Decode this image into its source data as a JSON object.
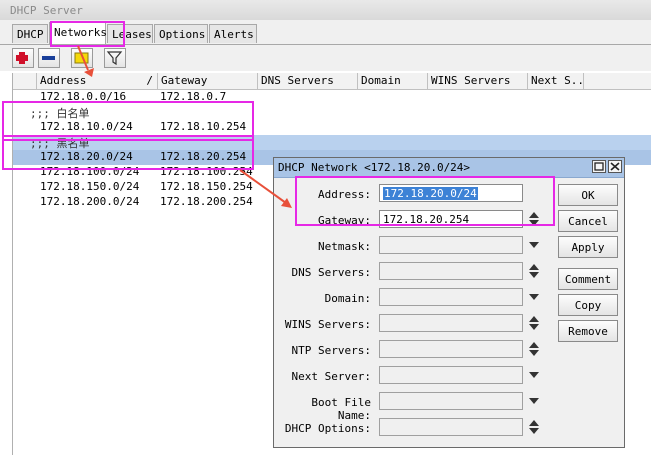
{
  "window": {
    "title": "DHCP Server"
  },
  "tabs": [
    "DHCP",
    "Networks",
    "Leases",
    "Options",
    "Alerts"
  ],
  "active_tab": "Networks",
  "toolbar": {
    "add_icon": "plus-icon",
    "remove_icon": "minus-icon",
    "comment_icon": "note-icon",
    "filter_icon": "filter-icon"
  },
  "table": {
    "columns": [
      "Address",
      "Gateway",
      "DNS Servers",
      "Domain",
      "WINS Servers",
      "Next S..."
    ],
    "sort_indicator": "/",
    "rows": [
      {
        "address": "172.18.0.0/16",
        "gateway": "172.18.0.7"
      },
      {
        "comment": ";;; 白名单"
      },
      {
        "address": "172.18.10.0/24",
        "gateway": "172.18.10.254"
      },
      {
        "comment": ";;; 黑名单"
      },
      {
        "address": "172.18.20.0/24",
        "gateway": "172.18.20.254"
      },
      {
        "address": "172.18.100.0/24",
        "gateway": "172.18.100.254"
      },
      {
        "address": "172.18.150.0/24",
        "gateway": "172.18.150.254"
      },
      {
        "address": "172.18.200.0/24",
        "gateway": "172.18.200.254"
      }
    ]
  },
  "dialog": {
    "title": "DHCP Network <172.18.20.0/24>",
    "fields": {
      "address": {
        "label": "Address:",
        "value": "172.18.20.0/24"
      },
      "gateway": {
        "label": "Gateway:",
        "value": "172.18.20.254"
      },
      "netmask": {
        "label": "Netmask:",
        "value": ""
      },
      "dns_servers": {
        "label": "DNS Servers:",
        "value": ""
      },
      "domain": {
        "label": "Domain:",
        "value": ""
      },
      "wins_servers": {
        "label": "WINS Servers:",
        "value": ""
      },
      "ntp_servers": {
        "label": "NTP Servers:",
        "value": ""
      },
      "next_server": {
        "label": "Next Server:",
        "value": ""
      },
      "boot_file_name": {
        "label": "Boot File Name:",
        "value": ""
      },
      "dhcp_options": {
        "label": "DHCP Options:",
        "value": ""
      }
    },
    "buttons": {
      "ok": "OK",
      "cancel": "Cancel",
      "apply": "Apply",
      "comment": "Comment",
      "copy": "Copy",
      "remove": "Remove"
    }
  },
  "colors": {
    "selection": "#a9c4e6",
    "annotation": "#e628e6",
    "arrow": "#e8503a"
  }
}
